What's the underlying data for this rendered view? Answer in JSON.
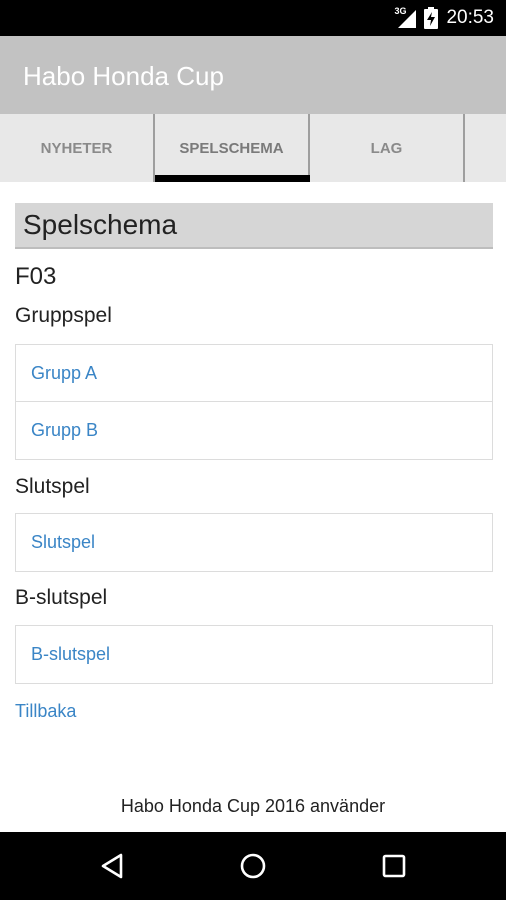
{
  "status_bar": {
    "time": "20:53",
    "network": "3G",
    "icons": [
      "signal-icon",
      "battery-charging-icon"
    ]
  },
  "app_bar": {
    "title": "Habo Honda Cup"
  },
  "tabs": [
    {
      "label": "NYHETER",
      "active": false
    },
    {
      "label": "SPELSCHEMA",
      "active": true
    },
    {
      "label": "LAG",
      "active": false
    },
    {
      "label": "",
      "active": false
    }
  ],
  "main": {
    "section_title": "Spelschema",
    "category": "F03",
    "groups": {
      "label": "Gruppspel",
      "items": [
        "Grupp A",
        "Grupp B"
      ]
    },
    "playoffs": {
      "label": "Slutspel",
      "items": [
        "Slutspel"
      ]
    },
    "b_playoffs": {
      "label": "B-slutspel",
      "items": [
        "B-slutspel"
      ]
    },
    "back_link": "Tillbaka"
  },
  "footer": {
    "text": "Habo Honda Cup 2016 använder"
  },
  "nav_bar": {
    "icons": [
      "back-icon",
      "home-icon",
      "recents-icon"
    ]
  },
  "colors": {
    "app_bar": "#c2c2c2",
    "link": "#3a85c6",
    "tab_bg": "#e8e8e8",
    "section_header_bg": "#d6d6d6"
  }
}
